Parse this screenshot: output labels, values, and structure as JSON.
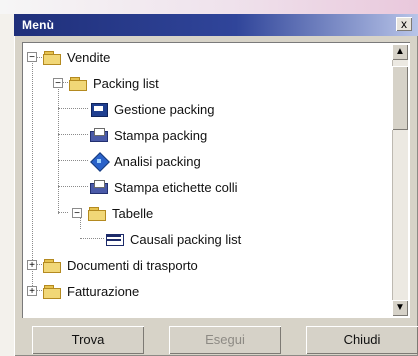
{
  "window": {
    "title": "Menù",
    "close_glyph": "x"
  },
  "tree": {
    "items": [
      {
        "label": "Vendite",
        "icon": "folder-icon",
        "toggle": "−"
      },
      {
        "label": "Packing list",
        "icon": "folder-icon",
        "toggle": "−"
      },
      {
        "label": "Gestione packing",
        "icon": "form-icon"
      },
      {
        "label": "Stampa packing",
        "icon": "print-icon"
      },
      {
        "label": "Analisi packing",
        "icon": "analysis-icon"
      },
      {
        "label": "Stampa etichette colli",
        "icon": "print-icon"
      },
      {
        "label": "Tabelle",
        "icon": "folder-icon",
        "toggle": "−"
      },
      {
        "label": "Causali packing list",
        "icon": "table-icon"
      },
      {
        "label": "Documenti di trasporto",
        "icon": "folder-icon",
        "toggle": "+"
      },
      {
        "label": "Fatturazione",
        "icon": "folder-icon",
        "toggle": "+"
      }
    ]
  },
  "scrollbar": {
    "up_glyph": "▲",
    "down_glyph": "▼"
  },
  "buttons": {
    "find": "Trova",
    "run": "Esegui",
    "close": "Chiudi"
  }
}
